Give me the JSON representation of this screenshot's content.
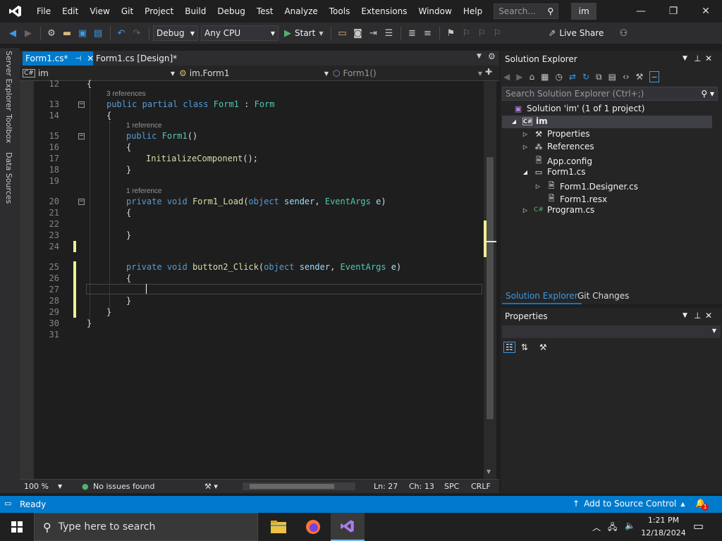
{
  "menu": {
    "items": [
      "File",
      "Edit",
      "View",
      "Git",
      "Project",
      "Build",
      "Debug",
      "Test",
      "Analyze",
      "Tools",
      "Extensions",
      "Window",
      "Help"
    ],
    "search_placeholder": "Search...",
    "profile": "im"
  },
  "toolbar": {
    "config": "Debug",
    "platform": "Any CPU",
    "start": "Start",
    "live_share": "Live Share"
  },
  "side_tabs": [
    "Server Explorer",
    "Toolbox",
    "Data Sources"
  ],
  "doc_tabs": [
    {
      "label": "Form1.cs*",
      "active": true
    },
    {
      "label": "Form1.cs [Design]*",
      "active": false
    }
  ],
  "nav": {
    "project": "im",
    "class": "im.Form1",
    "member": "Form1()"
  },
  "code": {
    "line_numbers": [
      "12",
      "13",
      "14",
      "15",
      "16",
      "17",
      "18",
      "19",
      "20",
      "21",
      "22",
      "23",
      "24",
      "25",
      "26",
      "27",
      "28",
      "29",
      "30",
      "31"
    ],
    "hints": [
      "3 references",
      "1 reference",
      "1 reference"
    ],
    "tokens": {
      "public": "public",
      "partial": "partial",
      "class": "class",
      "form1": "Form1",
      "colon": ":",
      "form": "Form",
      "open": "{",
      "close": "}",
      "ctor_sig": "()",
      "init": "InitializeComponent",
      "init_tail": "();",
      "private": "private",
      "void": "void",
      "form1_load": "Form1_Load",
      "object": "object",
      "sender": "sender",
      "eventargs": "EventArgs",
      "e": "e",
      "button2_click": "button2_Click",
      "lparen": "(",
      "comma": ",",
      "rparen": ")"
    }
  },
  "editor_status": {
    "zoom": "100 %",
    "issues": "No issues found",
    "ln": "Ln: 27",
    "ch": "Ch: 13",
    "spc": "SPC",
    "crlf": "CRLF"
  },
  "solution_explorer": {
    "title": "Solution Explorer",
    "search_placeholder": "Search Solution Explorer (Ctrl+;)",
    "tree": [
      {
        "label": "Solution 'im' (1 of 1 project)"
      },
      {
        "label": "im"
      },
      {
        "label": "Properties"
      },
      {
        "label": "References"
      },
      {
        "label": "App.config"
      },
      {
        "label": "Form1.cs"
      },
      {
        "label": "Form1.Designer.cs"
      },
      {
        "label": "Form1.resx"
      },
      {
        "label": "Program.cs"
      }
    ],
    "tabs": [
      "Solution Explorer",
      "Git Changes"
    ]
  },
  "properties": {
    "title": "Properties"
  },
  "status": {
    "ready": "Ready",
    "source_control": "Add to Source Control",
    "notif_count": "1"
  },
  "taskbar": {
    "search_placeholder": "Type here to search",
    "time": "1:21 PM",
    "date": "12/18/2024"
  },
  "colors": {
    "accent": "#007acc",
    "change_marker": "#efef91",
    "keyword": "#569cd6",
    "type": "#4ec9b0",
    "method": "#dcdcaa"
  }
}
